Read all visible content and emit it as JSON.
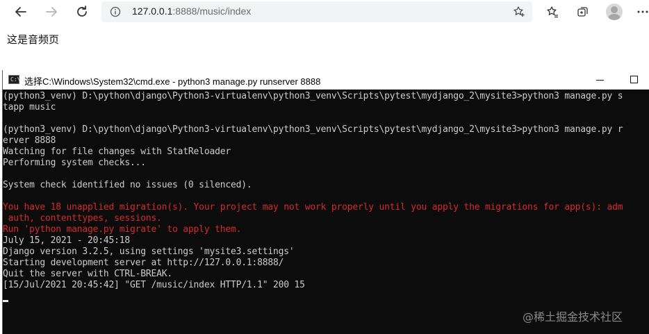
{
  "browser": {
    "url_host": "127.0.0.1",
    "url_rest": ":8888/music/index",
    "icons": [
      "back-arrow-icon",
      "forward-arrow-icon",
      "refresh-icon",
      "info-icon",
      "add-favorite-icon",
      "favorites-icon",
      "collections-icon",
      "profile-icon",
      "more-icon"
    ]
  },
  "page": {
    "text": "这是音频页"
  },
  "cmd": {
    "title": "选择C:\\Windows\\System32\\cmd.exe - python3  manage.py runserver 8888",
    "icon_text": "C:\\",
    "lines": [
      {
        "text": "(python3_venv) D:\\python\\django\\Python3-virtualenv\\python3_venv\\Scripts\\pytest\\mydjango_2\\mysite3>python3 manage.py s",
        "type": "normal"
      },
      {
        "text": "tapp music",
        "type": "normal"
      },
      {
        "text": "",
        "type": "normal"
      },
      {
        "text": "(python3_venv) D:\\python\\django\\Python3-virtualenv\\python3_venv\\Scripts\\pytest\\mydjango_2\\mysite3>python3 manage.py r",
        "type": "normal"
      },
      {
        "text": "erver 8888",
        "type": "normal"
      },
      {
        "text": "Watching for file changes with StatReloader",
        "type": "normal"
      },
      {
        "text": "Performing system checks...",
        "type": "normal"
      },
      {
        "text": "",
        "type": "normal"
      },
      {
        "text": "System check identified no issues (0 silenced).",
        "type": "normal"
      },
      {
        "text": "",
        "type": "normal"
      },
      {
        "text": "You have 18 unapplied migration(s). Your project may not work properly until you apply the migrations for app(s): adm",
        "type": "err"
      },
      {
        "text": " auth, contenttypes, sessions.",
        "type": "err"
      },
      {
        "text": "Run 'python manage.py migrate' to apply them.",
        "type": "err"
      },
      {
        "text": "July 15, 2021 - 20:45:18",
        "type": "normal"
      },
      {
        "text": "Django version 3.2.5, using settings 'mysite3.settings'",
        "type": "normal"
      },
      {
        "text": "Starting development server at http://127.0.0.1:8888/",
        "type": "normal"
      },
      {
        "text": "Quit the server with CTRL-BREAK.",
        "type": "normal"
      },
      {
        "text": "[15/Jul/2021 20:45:42] \"GET /music/index HTTP/1.1\" 200 15",
        "type": "normal"
      }
    ]
  },
  "watermark": "@稀土掘金技术社区",
  "colors": {
    "terminal_bg": "#0c0c0c",
    "terminal_text": "#cccccc",
    "terminal_error": "#d32b2b",
    "address_bar_bg": "#f1f3f4"
  }
}
